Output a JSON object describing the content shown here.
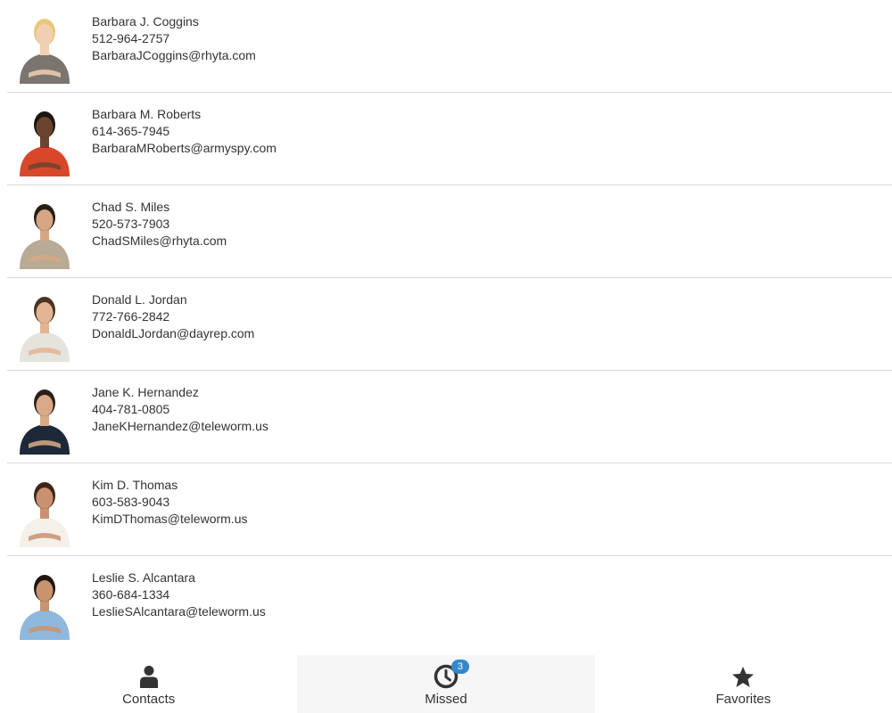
{
  "contacts": [
    {
      "name": "Barbara J. Coggins",
      "phone": "512-964-2757",
      "email": "BarbaraJCoggins@rhyta.com",
      "hair": "#e8c77a",
      "skin": "#f1cfb3",
      "shirt": "#7b7570",
      "bg": "#ffffff"
    },
    {
      "name": "Barbara M. Roberts",
      "phone": "614-365-7945",
      "email": "BarbaraMRoberts@armyspy.com",
      "hair": "#1c1512",
      "skin": "#6b4430",
      "shirt": "#d9472b",
      "bg": "#ffffff"
    },
    {
      "name": "Chad S. Miles",
      "phone": "520-573-7903",
      "email": "ChadSMiles@rhyta.com",
      "hair": "#2a1d16",
      "skin": "#d7a784",
      "shirt": "#b8ab95",
      "bg": "#ffffff"
    },
    {
      "name": "Donald L. Jordan",
      "phone": "772-766-2842",
      "email": "DonaldLJordan@dayrep.com",
      "hair": "#4a3324",
      "skin": "#e2b493",
      "shirt": "#e4e4dc",
      "bg": "#ffffff"
    },
    {
      "name": "Jane K. Hernandez",
      "phone": "404-781-0805",
      "email": "JaneKHernandez@teleworm.us",
      "hair": "#2b2019",
      "skin": "#d9aa88",
      "shirt": "#1d2838",
      "bg": "#ffffff"
    },
    {
      "name": "Kim D. Thomas",
      "phone": "603-583-9043",
      "email": "KimDThomas@teleworm.us",
      "hair": "#3d2618",
      "skin": "#c99171",
      "shirt": "#f4f0ea",
      "bg": "#ffffff"
    },
    {
      "name": "Leslie S. Alcantara",
      "phone": "360-684-1334",
      "email": "LeslieSAlcantara@teleworm.us",
      "hair": "#1f1611",
      "skin": "#c9936f",
      "shirt": "#8fb8df",
      "bg": "#ffffff"
    }
  ],
  "tabs": [
    {
      "label": "Contacts",
      "icon": "person-icon",
      "active": false
    },
    {
      "label": "Missed",
      "icon": "clock-icon",
      "active": true,
      "badge": "3"
    },
    {
      "label": "Favorites",
      "icon": "star-icon",
      "active": false
    }
  ],
  "colors": {
    "text": "#333333",
    "divider": "#d9d9d9",
    "active_tab_bg": "#f6f6f6",
    "badge": "#3388cc"
  }
}
